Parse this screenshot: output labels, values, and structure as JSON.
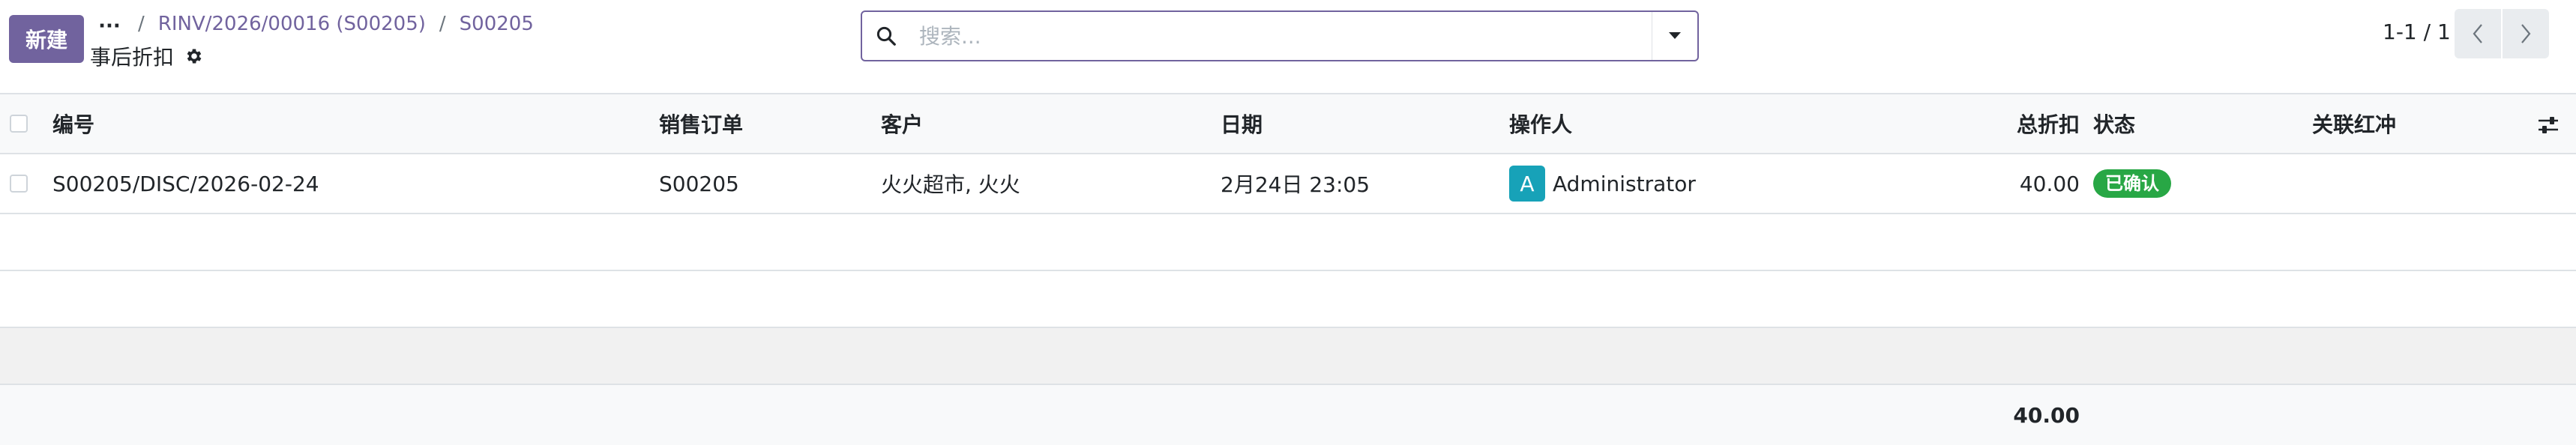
{
  "toolbar": {
    "new_label": "新建",
    "more_label": "···"
  },
  "breadcrumb": {
    "items": [
      "RINV/2026/00016 (S00205)",
      "S00205"
    ],
    "separator": "/"
  },
  "page": {
    "title": "事后折扣"
  },
  "search": {
    "placeholder": "搜索..."
  },
  "pager": {
    "value": "1-1 / 1"
  },
  "table": {
    "columns": [
      "编号",
      "销售订单",
      "客户",
      "日期",
      "操作人",
      "总折扣",
      "状态",
      "关联红冲"
    ],
    "rows": [
      {
        "number": "S00205/DISC/2026-02-24",
        "sale_order": "S00205",
        "customer": "火火超市, 火火",
        "date": "2月24日 23:05",
        "operator_initial": "A",
        "operator": "Administrator",
        "total_discount": "40.00",
        "status": "已确认",
        "linked_reversal": ""
      }
    ],
    "footer_total": "40.00"
  },
  "colors": {
    "brand": "#71639e",
    "status_confirmed": "#28a745",
    "avatar": "#17a2b8"
  },
  "icons": {
    "gear": "gear-icon",
    "search": "search-icon",
    "dropdown": "caret-down-icon",
    "prev": "chevron-left-icon",
    "next": "chevron-right-icon",
    "optional_columns": "sliders-icon"
  }
}
